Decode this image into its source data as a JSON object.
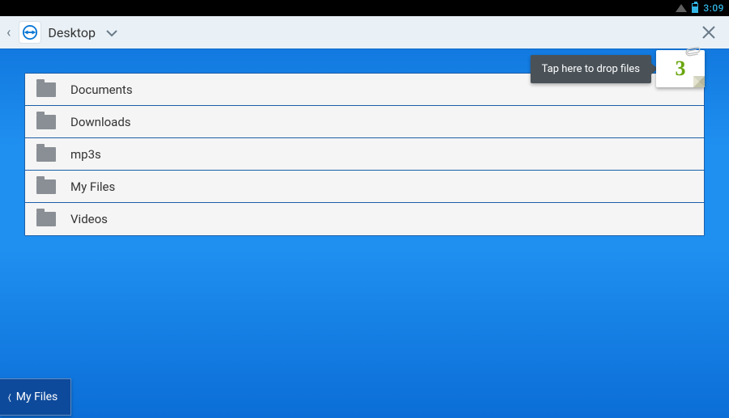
{
  "statusbar": {
    "time": "3:09"
  },
  "header": {
    "location": "Desktop"
  },
  "drop": {
    "tooltip_text": "Tap here to drop files",
    "badge_count": "3"
  },
  "files": [
    {
      "name": "Documents"
    },
    {
      "name": "Downloads"
    },
    {
      "name": "mp3s"
    },
    {
      "name": "My Files"
    },
    {
      "name": "Videos"
    }
  ],
  "bottom_nav": {
    "label": "My Files"
  }
}
